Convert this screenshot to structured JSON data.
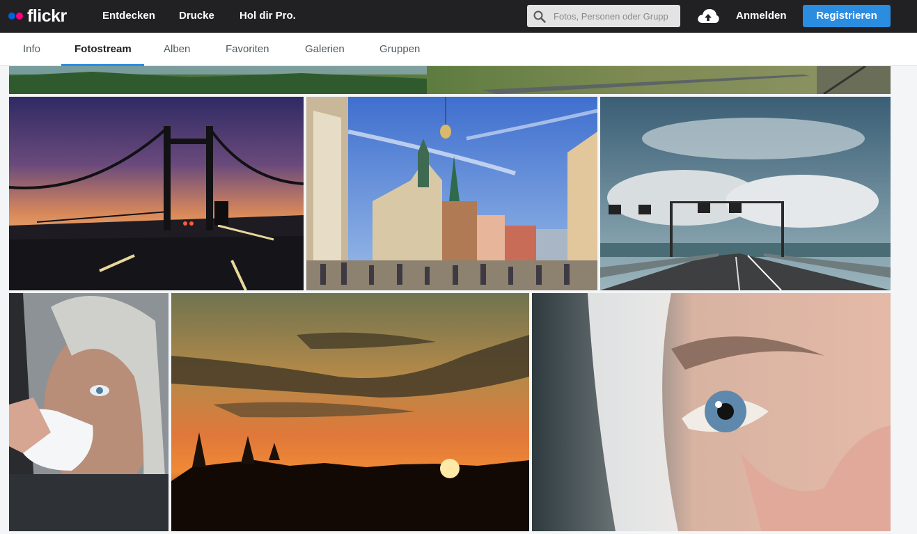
{
  "header": {
    "logo_text": "flickr",
    "nav": [
      "Entdecken",
      "Drucke",
      "Hol dir Pro."
    ],
    "search_placeholder": "Fotos, Personen oder Grupp",
    "signin_label": "Anmelden",
    "register_label": "Registrieren"
  },
  "subnav": {
    "tabs": [
      "Info",
      "Fotostream",
      "Alben",
      "Favoriten",
      "Galerien",
      "Gruppen"
    ],
    "active_tab": "Fotostream"
  },
  "colors": {
    "topbar": "#212124",
    "accent": "#2b8de0",
    "logo_blue": "#0063dc",
    "logo_pink": "#ff0084"
  },
  "photos": [
    {
      "subject": "landscape-strip-top"
    },
    {
      "subject": "bridge-at-sunset"
    },
    {
      "subject": "city-square-towers"
    },
    {
      "subject": "highway-bridge-clouds"
    },
    {
      "subject": "man-drinking-from-cup"
    },
    {
      "subject": "sunset-over-forest"
    },
    {
      "subject": "eye-closeup"
    }
  ]
}
